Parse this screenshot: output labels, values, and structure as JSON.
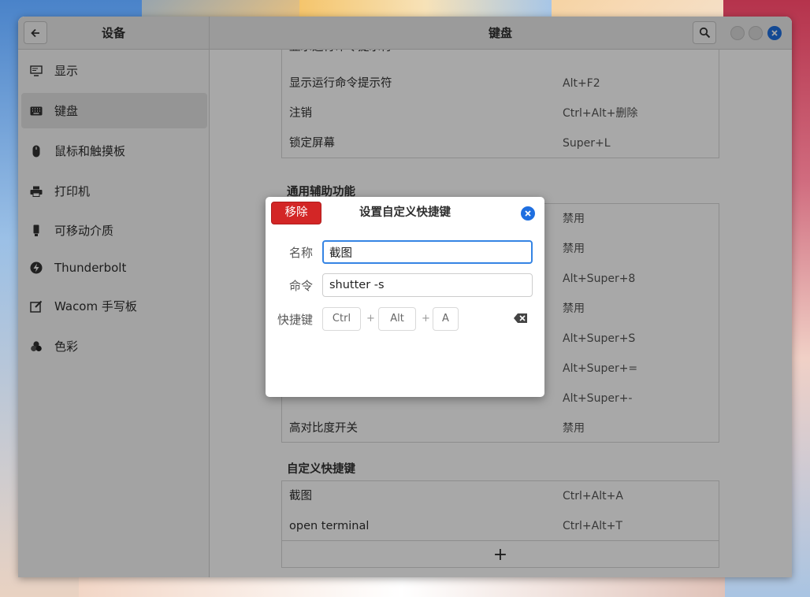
{
  "window": {
    "sidebar_title": "设备",
    "main_title": "键盘"
  },
  "sidebar": {
    "items": [
      {
        "label": "显示",
        "icon": "display-icon"
      },
      {
        "label": "键盘",
        "icon": "keyboard-icon",
        "selected": true
      },
      {
        "label": "鼠标和触摸板",
        "icon": "mouse-icon"
      },
      {
        "label": "打印机",
        "icon": "printer-icon"
      },
      {
        "label": "可移动介质",
        "icon": "usb-drive-icon"
      },
      {
        "label": "Thunderbolt",
        "icon": "thunderbolt-icon"
      },
      {
        "label": "Wacom 手写板",
        "icon": "tablet-icon"
      },
      {
        "label": "色彩",
        "icon": "color-icon"
      }
    ]
  },
  "shortcuts": {
    "clipped_top_label": "显示运行命令提示符",
    "system_rows": [
      {
        "name": "显示运行命令提示符",
        "key": "Alt+F2"
      },
      {
        "name": "注销",
        "key": "Ctrl+Alt+删除"
      },
      {
        "name": "锁定屏幕",
        "key": "Super+L"
      }
    ],
    "accessibility_header": "通用辅助功能",
    "accessibility_rows": [
      {
        "name": "",
        "key": "禁用"
      },
      {
        "name": "",
        "key": "禁用"
      },
      {
        "name": "",
        "key": "Alt+Super+8"
      },
      {
        "name": "",
        "key": "禁用"
      },
      {
        "name": "",
        "key": "Alt+Super+S"
      },
      {
        "name": "",
        "key": "Alt+Super+="
      },
      {
        "name": "",
        "key": "Alt+Super+-"
      },
      {
        "name": "高对比度开关",
        "key": "禁用"
      }
    ],
    "custom_header": "自定义快捷键",
    "custom_rows": [
      {
        "name": "截图",
        "key": "Ctrl+Alt+A"
      },
      {
        "name": "open terminal",
        "key": "Ctrl+Alt+T"
      }
    ],
    "add_label": "+"
  },
  "dialog": {
    "title": "设置自定义快捷键",
    "remove_label": "移除",
    "name_label": "名称",
    "name_value": "截图",
    "command_label": "命令",
    "command_value": "shutter -s",
    "shortcut_label": "快捷键",
    "keys": [
      "Ctrl",
      "Alt",
      "A"
    ],
    "plus": "+"
  },
  "colors": {
    "accent": "#3584e4",
    "close_button": "#1f6fe0",
    "destructive": "#d32626"
  }
}
